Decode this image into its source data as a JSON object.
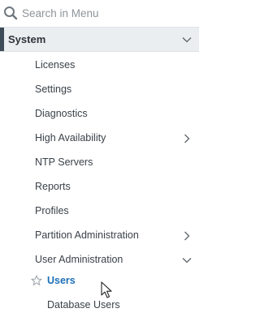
{
  "search": {
    "placeholder": "Search in Menu",
    "icon": "search-icon"
  },
  "section": {
    "label": "System",
    "expanded": true,
    "accent_color": "#3d4a57"
  },
  "menu": {
    "items": [
      {
        "label": "Licenses",
        "has_submenu": false
      },
      {
        "label": "Settings",
        "has_submenu": false
      },
      {
        "label": "Diagnostics",
        "has_submenu": false
      },
      {
        "label": "High Availability",
        "has_submenu": true,
        "expanded": false
      },
      {
        "label": "NTP Servers",
        "has_submenu": false
      },
      {
        "label": "Reports",
        "has_submenu": false
      },
      {
        "label": "Profiles",
        "has_submenu": false
      },
      {
        "label": "Partition Administration",
        "has_submenu": true,
        "expanded": false
      },
      {
        "label": "User Administration",
        "has_submenu": true,
        "expanded": true
      }
    ]
  },
  "submenu": {
    "items": [
      {
        "label": "Users",
        "active": true,
        "favorite_icon": "star-outline-icon",
        "color": "#1f6fb6"
      },
      {
        "label": "Database Users",
        "active": false
      }
    ]
  }
}
